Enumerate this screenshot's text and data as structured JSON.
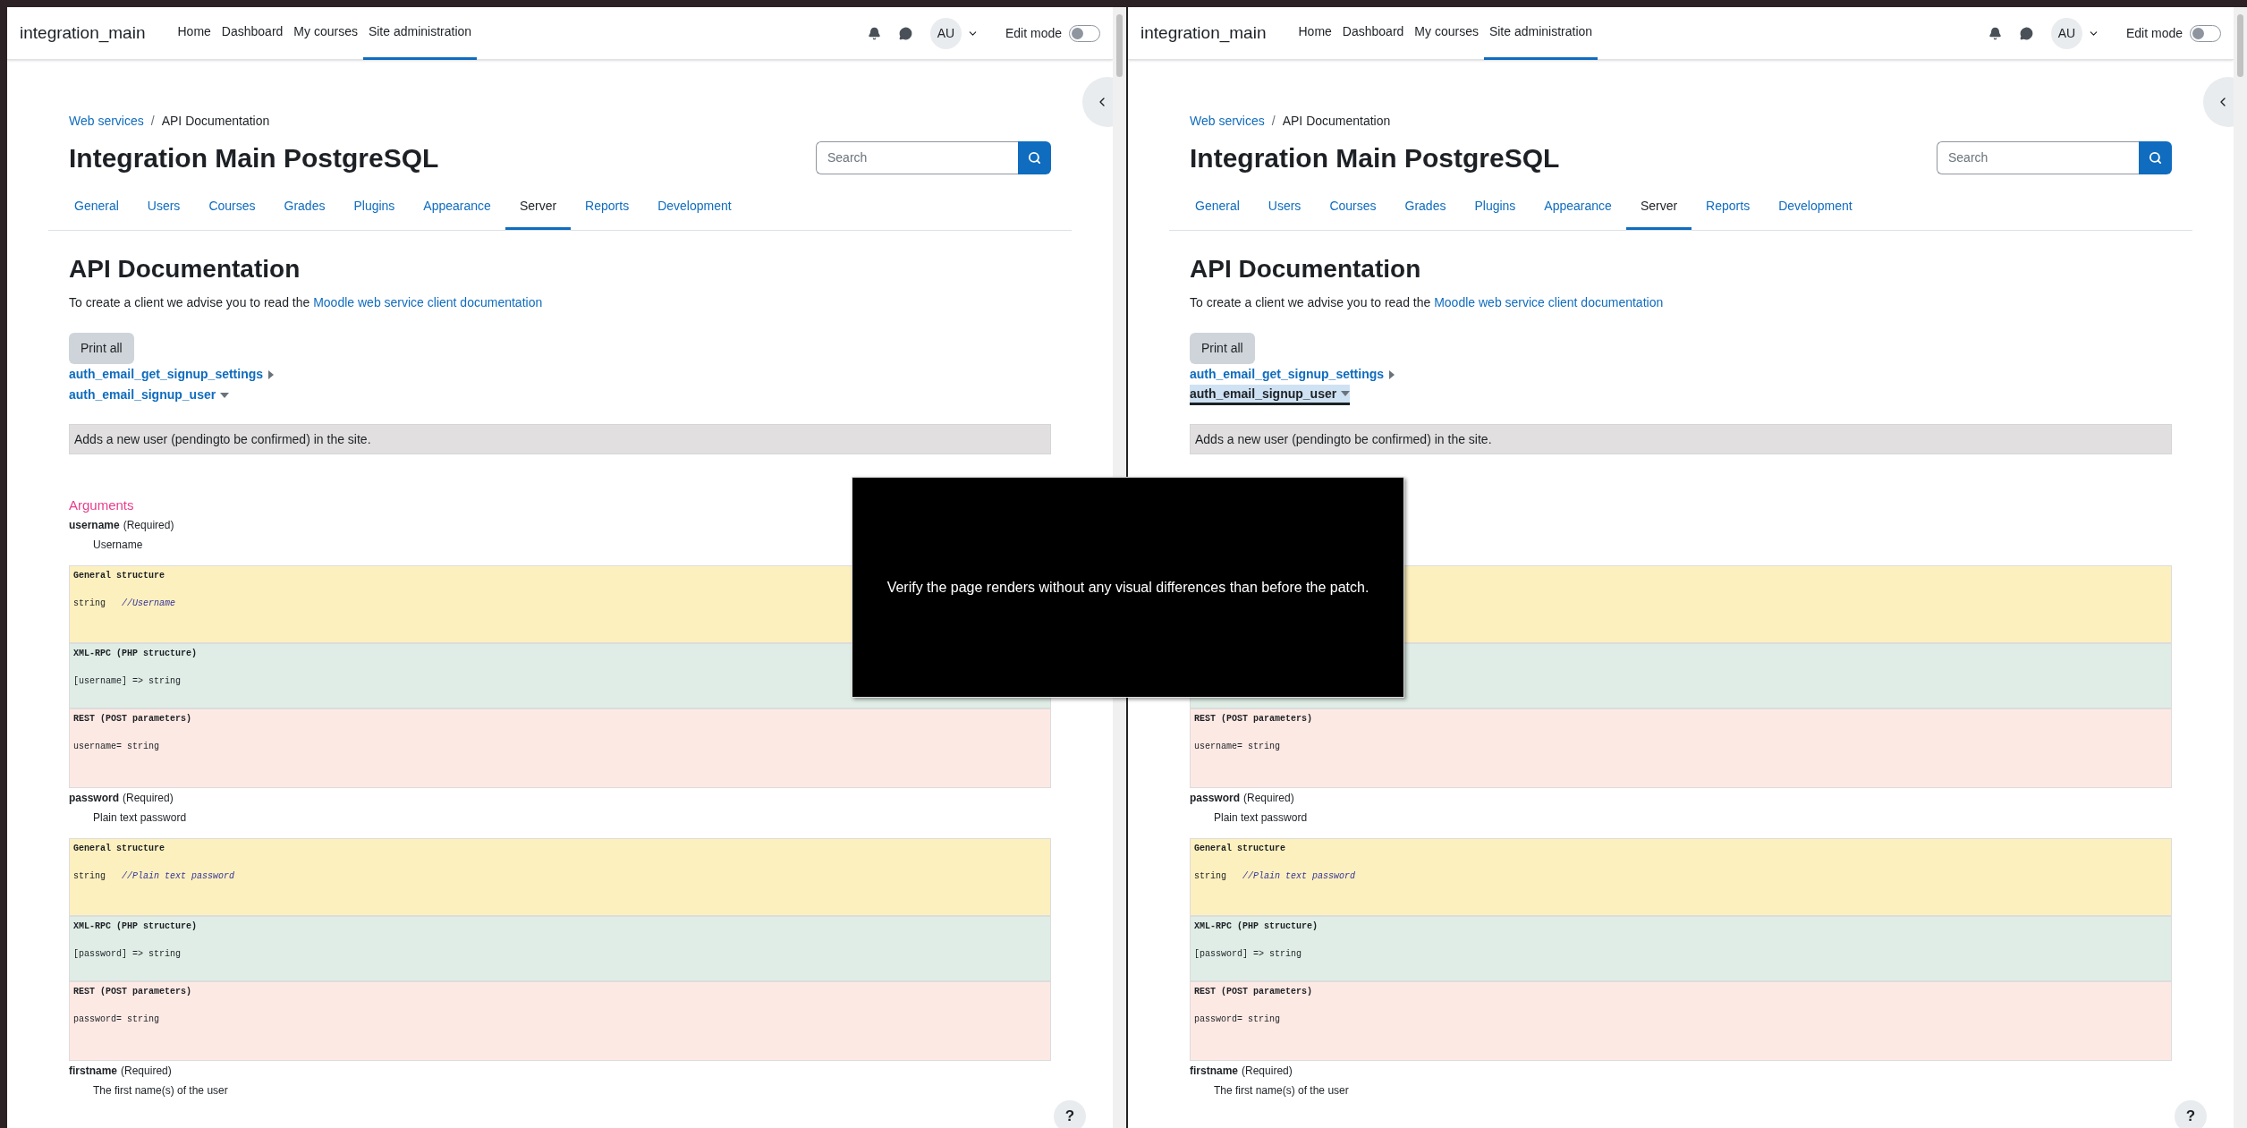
{
  "panes": [
    {
      "site_name": "integration_main",
      "nav": [
        {
          "label": "Home",
          "selected": false
        },
        {
          "label": "Dashboard",
          "selected": false
        },
        {
          "label": "My courses",
          "selected": false
        },
        {
          "label": "Site administration",
          "selected": true
        }
      ],
      "user_initials": "AU",
      "edit_mode": {
        "label": "Edit mode",
        "on": false
      },
      "breadcrumb": [
        "Web services",
        "API Documentation"
      ],
      "breadcrumb_separator": "/",
      "title": "Integration Main PostgreSQL",
      "search": {
        "placeholder": "Search"
      },
      "tabs": [
        {
          "label": "General",
          "selected": false
        },
        {
          "label": "Users",
          "selected": false
        },
        {
          "label": "Courses",
          "selected": false
        },
        {
          "label": "Grades",
          "selected": false
        },
        {
          "label": "Plugins",
          "selected": false
        },
        {
          "label": "Appearance",
          "selected": false
        },
        {
          "label": "Server",
          "selected": true
        },
        {
          "label": "Reports",
          "selected": false
        },
        {
          "label": "Development",
          "selected": false
        }
      ],
      "heading": "API Documentation",
      "intro": "To create a client we advise you to read the",
      "intro_link": "Moodle web service client documentation",
      "print_all": "Print all",
      "functions": [
        {
          "name": "auth_email_get_signup_settings",
          "expanded": false,
          "focused": false
        },
        {
          "name": "auth_email_signup_user",
          "expanded": true,
          "focused": false
        }
      ],
      "description": "Adds a new user (pendingto be confirmed) in the site.",
      "arguments_heading": "Arguments",
      "arguments": [
        {
          "name": "username",
          "required_label": "(Required)",
          "description": "Username",
          "blocks": [
            {
              "kind": "general",
              "title": "General structure",
              "code": "string",
              "comment": "//Username"
            },
            {
              "kind": "xmlrpc",
              "title": "XML-RPC (PHP structure)",
              "code": "[username] => string"
            },
            {
              "kind": "rest",
              "title": "REST (POST parameters)",
              "code": "username= string"
            }
          ]
        },
        {
          "name": "password",
          "required_label": "(Required)",
          "description": "Plain text password",
          "blocks": [
            {
              "kind": "general",
              "title": "General structure",
              "code": "string",
              "comment": "//Plain text password"
            },
            {
              "kind": "xmlrpc",
              "title": "XML-RPC (PHP structure)",
              "code": "[password] => string"
            },
            {
              "kind": "rest",
              "title": "REST (POST parameters)",
              "code": "password= string"
            }
          ]
        },
        {
          "name": "firstname",
          "required_label": "(Required)",
          "description": "The first name(s) of the user"
        }
      ],
      "help": "?"
    },
    {
      "site_name": "integration_main",
      "nav": [
        {
          "label": "Home",
          "selected": false
        },
        {
          "label": "Dashboard",
          "selected": false
        },
        {
          "label": "My courses",
          "selected": false
        },
        {
          "label": "Site administration",
          "selected": true
        }
      ],
      "user_initials": "AU",
      "edit_mode": {
        "label": "Edit mode",
        "on": false
      },
      "breadcrumb": [
        "Web services",
        "API Documentation"
      ],
      "breadcrumb_separator": "/",
      "title": "Integration Main PostgreSQL",
      "search": {
        "placeholder": "Search"
      },
      "tabs": [
        {
          "label": "General",
          "selected": false
        },
        {
          "label": "Users",
          "selected": false
        },
        {
          "label": "Courses",
          "selected": false
        },
        {
          "label": "Grades",
          "selected": false
        },
        {
          "label": "Plugins",
          "selected": false
        },
        {
          "label": "Appearance",
          "selected": false
        },
        {
          "label": "Server",
          "selected": true
        },
        {
          "label": "Reports",
          "selected": false
        },
        {
          "label": "Development",
          "selected": false
        }
      ],
      "heading": "API Documentation",
      "intro": "To create a client we advise you to read the",
      "intro_link": "Moodle web service client documentation",
      "print_all": "Print all",
      "functions": [
        {
          "name": "auth_email_get_signup_settings",
          "expanded": false,
          "focused": false
        },
        {
          "name": "auth_email_signup_user",
          "expanded": true,
          "focused": true
        }
      ],
      "description": "Adds a new user (pendingto be confirmed) in the site.",
      "arguments": [
        {
          "blocks": [
            {
              "kind": "general"
            },
            {
              "kind": "xmlrpc"
            },
            {
              "kind": "rest",
              "title": "REST (POST parameters)",
              "code": "username= string"
            }
          ]
        },
        {
          "name": "password",
          "required_label": "(Required)",
          "description": "Plain text password",
          "blocks": [
            {
              "kind": "general",
              "title": "General structure",
              "code": "string",
              "comment": "//Plain text password"
            },
            {
              "kind": "xmlrpc",
              "title": "XML-RPC (PHP structure)",
              "code": "[password] => string"
            },
            {
              "kind": "rest",
              "title": "REST (POST parameters)",
              "code": "password= string"
            }
          ]
        },
        {
          "name": "firstname",
          "required_label": "(Required)",
          "description": "The first name(s) of the user"
        }
      ],
      "help": "?"
    }
  ],
  "overlay": {
    "text": "Verify the page renders without any visual differences than before the patch."
  }
}
